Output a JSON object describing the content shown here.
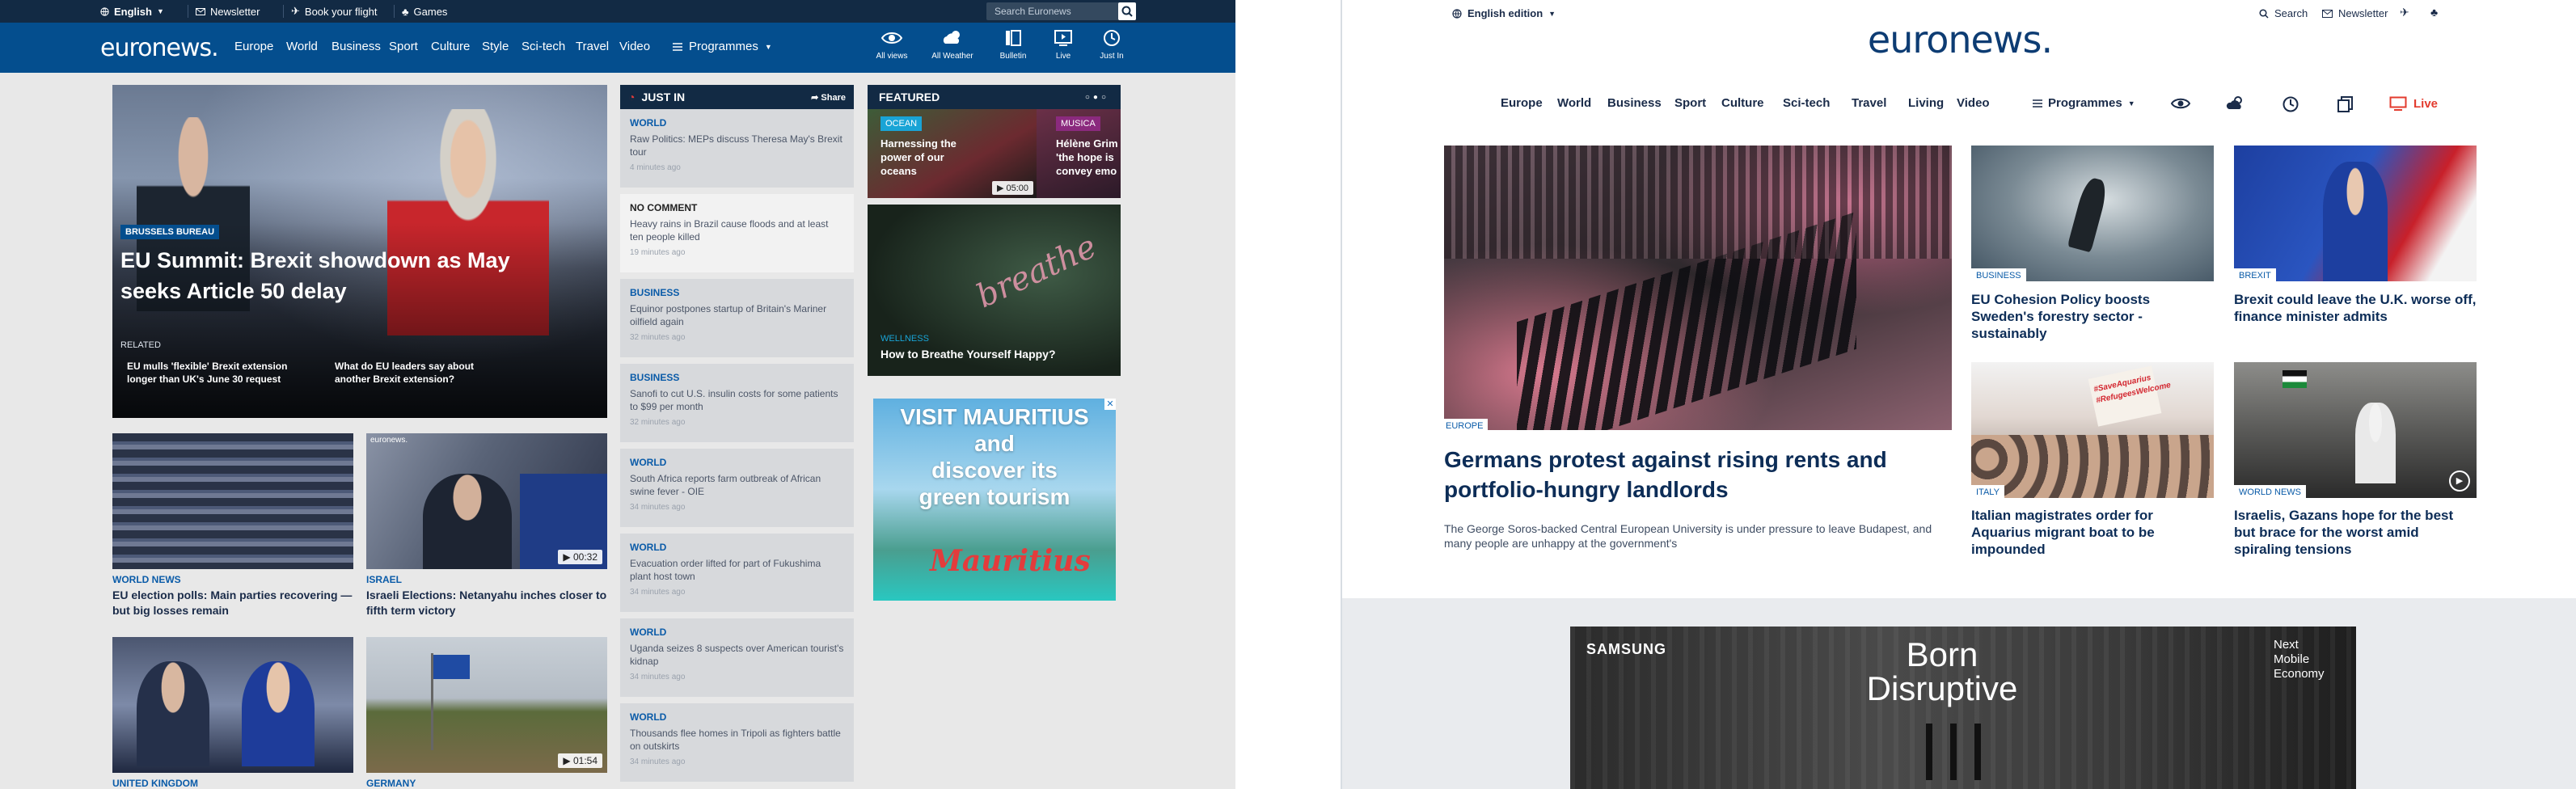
{
  "left": {
    "topbar": {
      "language": "English",
      "newsletter": "Newsletter",
      "book_flight": "Book your flight",
      "games": "Games",
      "search_placeholder": "Search Euronews"
    },
    "nav": {
      "logo": "euronews.",
      "items": [
        "Europe",
        "World",
        "Business",
        "Sport",
        "Culture",
        "Style",
        "Sci-tech",
        "Travel",
        "Video"
      ],
      "programmes": "Programmes",
      "icons": [
        {
          "label": "All views",
          "icon": "eye-icon"
        },
        {
          "label": "All Weather",
          "icon": "weather-icon"
        },
        {
          "label": "Bulletin",
          "icon": "bulletin-icon"
        },
        {
          "label": "Live",
          "icon": "tv-icon"
        },
        {
          "label": "Just In",
          "icon": "clock-icon"
        }
      ]
    },
    "hero": {
      "tag": "BRUSSELS BUREAU",
      "headline": "EU Summit: Brexit showdown as May seeks Article 50 delay",
      "related_label": "RELATED",
      "related": [
        "EU mulls 'flexible' Brexit extension longer than UK's June 30 request",
        "What do EU leaders say about another Brexit extension?"
      ]
    },
    "cards": [
      {
        "category": "WORLD NEWS",
        "headline": "EU election polls: Main parties recovering — but big losses remain",
        "duration": ""
      },
      {
        "category": "ISRAEL",
        "headline": "Israeli Elections: Netanyahu inches closer to fifth term victory",
        "duration": "00:32",
        "watermark": "euronews."
      },
      {
        "category": "UNITED KINGDOM",
        "headline": "",
        "duration": ""
      },
      {
        "category": "GERMANY",
        "headline": "",
        "duration": "01:54"
      }
    ],
    "just_in": {
      "title": "JUST IN",
      "share": "Share",
      "items": [
        {
          "category": "WORLD",
          "text": "Raw Politics: MEPs discuss Theresa May's Brexit tour",
          "time": "4 minutes ago"
        },
        {
          "category": "NO COMMENT",
          "text": "Heavy rains in Brazil cause floods and at least ten people killed",
          "time": "19 minutes ago"
        },
        {
          "category": "BUSINESS",
          "text": "Equinor postpones startup of Britain's Mariner oilfield again",
          "time": "32 minutes ago"
        },
        {
          "category": "BUSINESS",
          "text": "Sanofi to cut U.S. insulin costs for some patients to $99 per month",
          "time": "32 minutes ago"
        },
        {
          "category": "WORLD",
          "text": "South Africa reports farm outbreak of African swine fever - OIE",
          "time": "34 minutes ago"
        },
        {
          "category": "WORLD",
          "text": "Evacuation order lifted for part of Fukushima plant host town",
          "time": "34 minutes ago"
        },
        {
          "category": "WORLD",
          "text": "Uganda seizes 8 suspects over American tourist's kidnap",
          "time": "34 minutes ago"
        },
        {
          "category": "WORLD",
          "text": "Thousands flee homes in Tripoli as fighters battle on outskirts",
          "time": "34 minutes ago"
        }
      ]
    },
    "featured": {
      "title": "FEATURED",
      "items": [
        {
          "tag": "OCEAN",
          "headline": "Harnessing the power of our oceans",
          "duration": "05:00"
        },
        {
          "tag": "MUSICA",
          "headline": "Hélène Grim 'the hope is convey emo"
        },
        {
          "tag": "WELLNESS",
          "headline": "How to Breathe Yourself Happy?",
          "overlay": "breathe"
        }
      ]
    },
    "ad": {
      "line1": "VISIT MAURITIUS",
      "line2": "and",
      "line3": "discover its",
      "line4": "green tourism",
      "brand": "Mauritius"
    }
  },
  "right": {
    "topbar": {
      "edition": "English edition",
      "search": "Search",
      "newsletter": "Newsletter"
    },
    "logo": "euronews.",
    "nav": {
      "items": [
        "Europe",
        "World",
        "Business",
        "Sport",
        "Culture",
        "Sci-tech",
        "Travel",
        "Living",
        "Video"
      ],
      "programmes": "Programmes",
      "live": "Live"
    },
    "main": {
      "category": "EUROPE",
      "headline": "Germans protest against rising rents and portfolio-hungry landlords",
      "summary": "The George Soros-backed Central European University is under pressure to leave Budapest, and many people are unhappy at the government's"
    },
    "grid": [
      {
        "category": "BUSINESS",
        "headline": "EU Cohesion Policy boosts Sweden's forestry sector - sustainably"
      },
      {
        "category": "BREXIT",
        "headline": "Brexit could leave the U.K. worse off, finance minister admits"
      },
      {
        "category": "ITALY",
        "headline": "Italian magistrates order for Aquarius migrant boat to be impounded",
        "sign": "#SaveAquarius #RefugeesWelcome"
      },
      {
        "category": "WORLD NEWS",
        "headline": "Israelis, Gazans hope for the best but brace for the worst amid spiraling tensions"
      }
    ],
    "ad": {
      "brand": "SAMSUNG",
      "slogan_1": "Born",
      "slogan_2": "Disruptive",
      "tagline_1": "Next",
      "tagline_2": "Mobile",
      "tagline_3": "Economy"
    }
  }
}
